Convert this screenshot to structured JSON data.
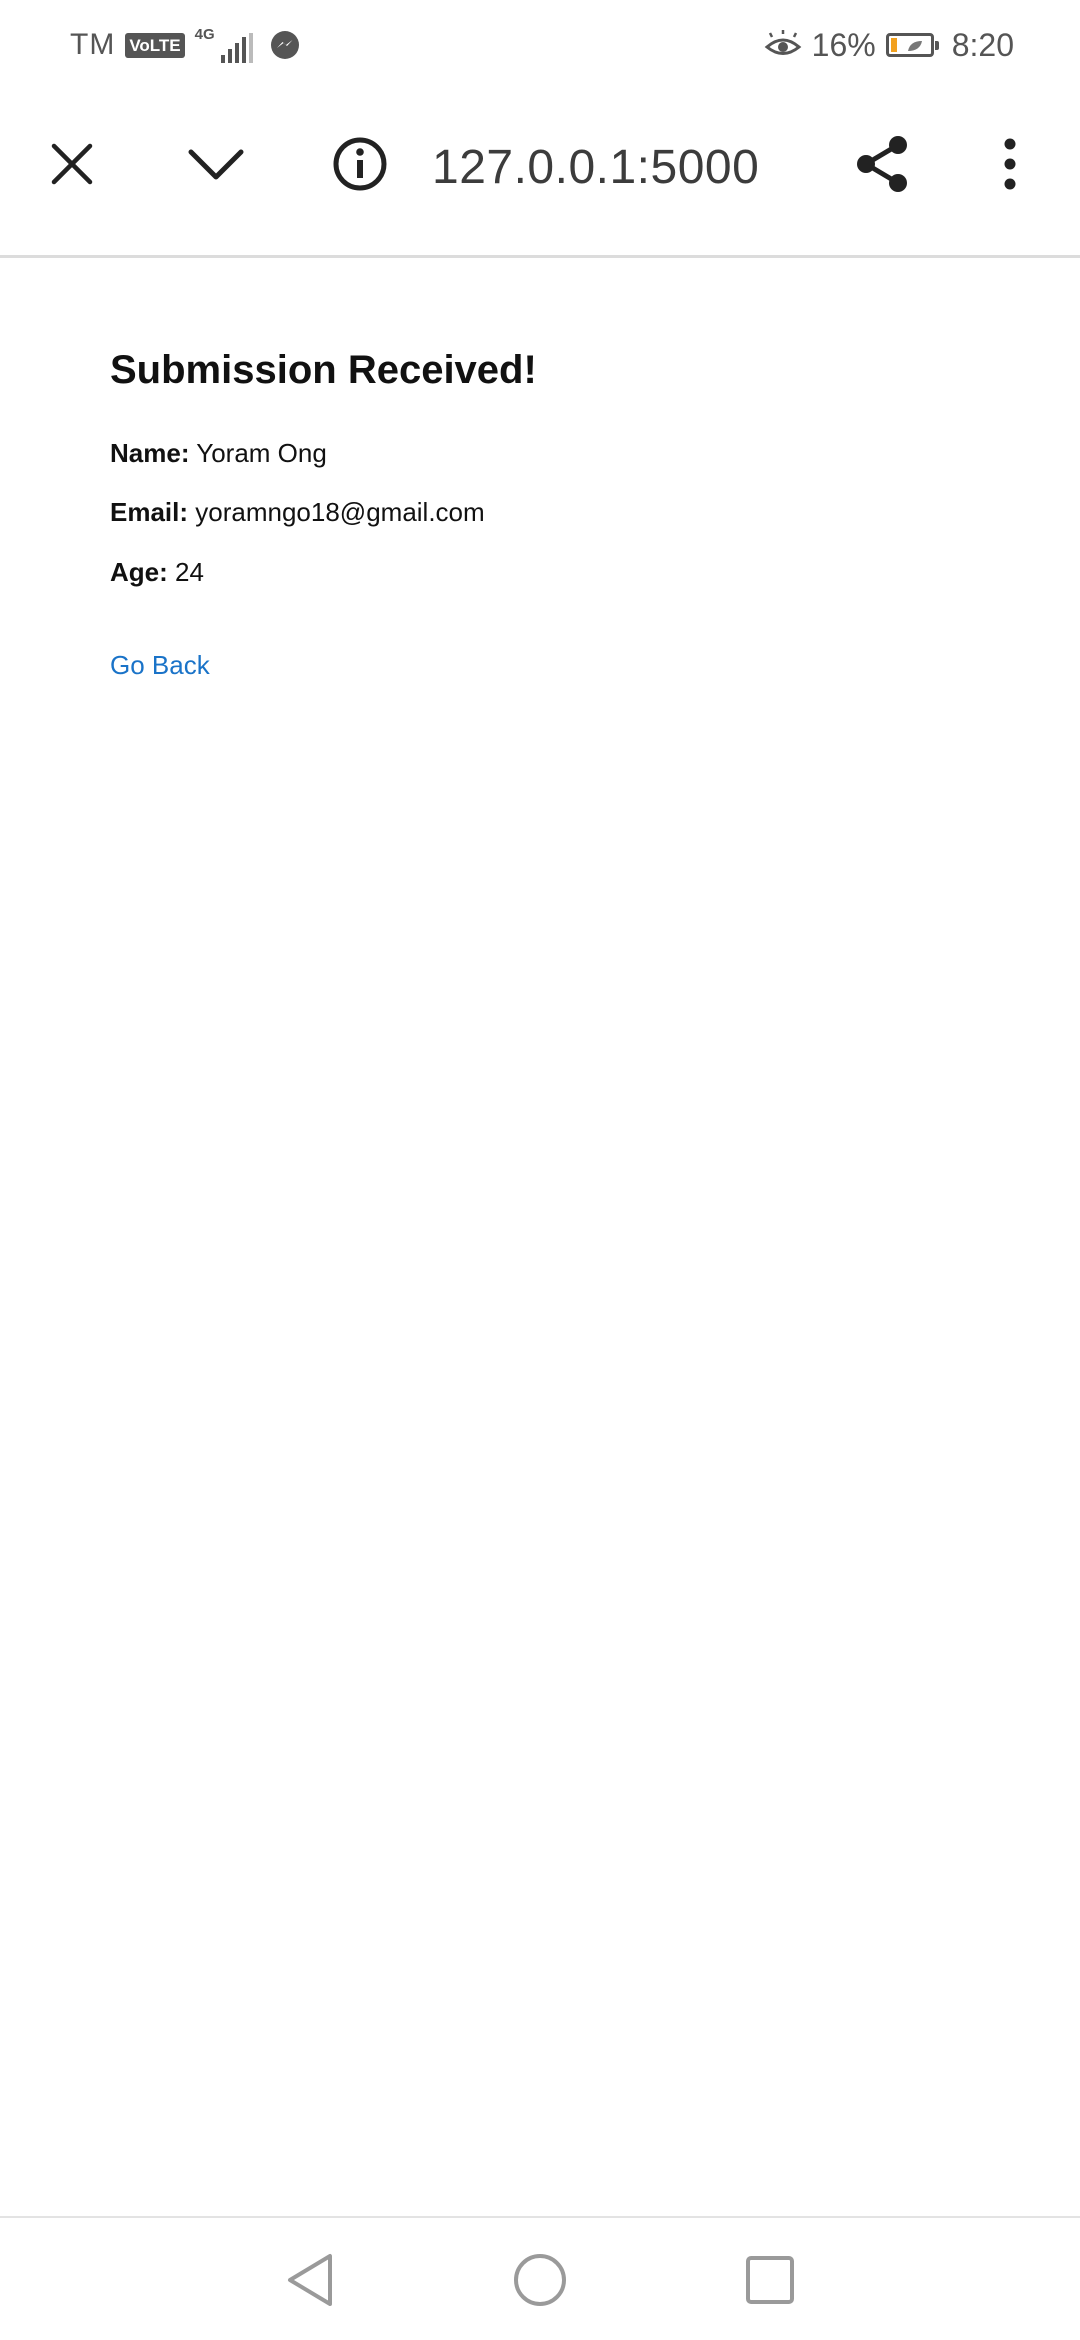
{
  "status_bar": {
    "carrier": "TM",
    "volte_label": "VoLTE",
    "network_type": "4G",
    "battery_percent": "16%",
    "battery_level": 0.16,
    "time": "8:20",
    "battery_color": "#f2a11f"
  },
  "browser": {
    "url": "127.0.0.1:5000",
    "icons": {
      "close": "close-icon",
      "collapse": "chevron-down-icon",
      "info": "info-icon",
      "share": "share-icon",
      "menu": "more-vert-icon"
    }
  },
  "page": {
    "title": "Submission Received!",
    "fields": [
      {
        "label": "Name:",
        "value": "Yoram Ong"
      },
      {
        "label": "Email:",
        "value": "yoramngo18@gmail.com"
      },
      {
        "label": "Age:",
        "value": "24"
      }
    ],
    "back_link": "Go Back",
    "link_color": "#1a73c8"
  },
  "nav_bar": {
    "icons": [
      "back-icon",
      "home-icon",
      "recents-icon"
    ]
  }
}
